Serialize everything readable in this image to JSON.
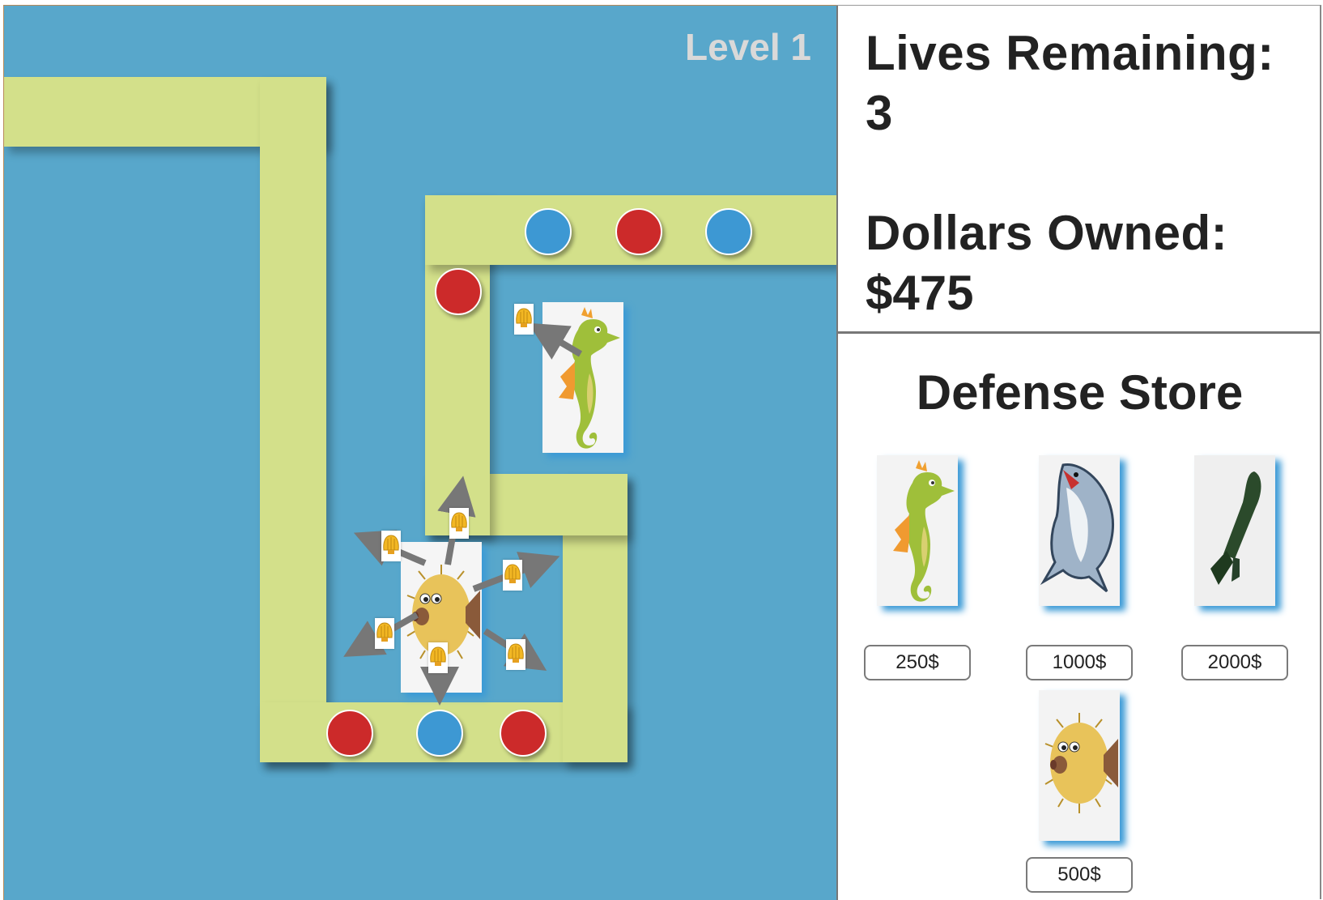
{
  "game": {
    "level_label": "Level 1",
    "colors": {
      "water": "#58a7cb",
      "path": "#d3e08a",
      "enemy_red": "#cc2a2a",
      "enemy_blue": "#3d98d3",
      "tower_glow": "#3b9ad6"
    }
  },
  "board": {
    "enemies": [
      "blue",
      "red",
      "blue",
      "red",
      "red",
      "blue",
      "red"
    ],
    "towers": [
      "seahorse-tower",
      "pufferfish-tower"
    ],
    "projectiles": [
      "shell",
      "shell",
      "shell",
      "shell",
      "shell",
      "shell",
      "shell"
    ]
  },
  "stats": {
    "lives_label": "Lives Remaining:",
    "lives_value": "3",
    "dollars_label": "Dollars Owned:",
    "dollars_value": "$475"
  },
  "store": {
    "title": "Defense Store",
    "items": [
      {
        "icon": "seahorse-icon",
        "price": "250$"
      },
      {
        "icon": "shark-icon",
        "price": "1000$"
      },
      {
        "icon": "torpedo-icon",
        "price": "2000$"
      },
      {
        "icon": "pufferfish-icon",
        "price": "500$"
      }
    ]
  }
}
